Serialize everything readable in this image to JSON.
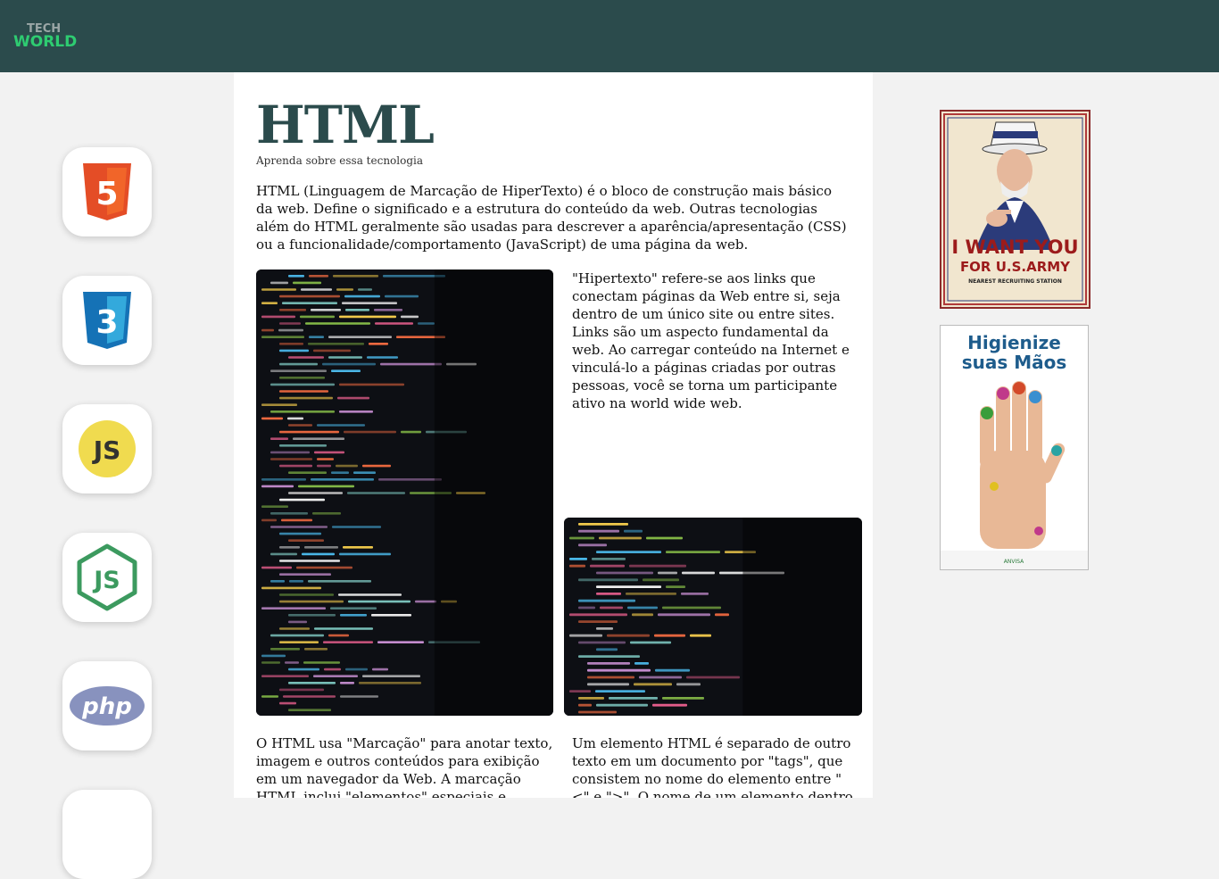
{
  "brand": {
    "line1": "TECH",
    "line2": "WORLD"
  },
  "sidebar": {
    "items": [
      {
        "name": "html5",
        "label": "5"
      },
      {
        "name": "css3",
        "label": "3"
      },
      {
        "name": "javascript",
        "label": "JS"
      },
      {
        "name": "nodejs",
        "label": "JS"
      },
      {
        "name": "php",
        "label": "php"
      }
    ]
  },
  "article": {
    "title": "HTML",
    "subtitle": "Aprenda sobre essa tecnologia",
    "intro": "HTML (Linguagem de Marcação de HiperTexto) é o bloco de construção mais básico da web. Define o significado e a estrutura do conteúdo da web. Outras tecnologias além do HTML geralmente são usadas para descrever a aparência/apresentação (CSS) ou a funcionalidade/comportamento (JavaScript) de uma página da web.",
    "hypertext": "\"Hipertexto\" refere-se aos links que conectam páginas da Web entre si, seja dentro de um único site ou entre sites. Links são um aspecto fundamental da web. Ao carregar conteúdo na Internet e vinculá-lo a páginas criadas por outras pessoas, você se torna um participante ativo na world wide web.",
    "markup": "O HTML usa \"Marcação\" para anotar texto, imagem e outros conteúdos para exibição em um navegador da Web. A marcação HTML inclui \"elementos\" especiais e muitos outros",
    "tags": "Um elemento HTML é separado de outro texto em um documento por \"tags\", que consistem no nome do elemento entre \"<\" e \">\". O nome de um elemento dentro de uma tag é insensível"
  },
  "ads": {
    "army": {
      "line1": "I WANT YOU",
      "line2": "FOR U.S.ARMY",
      "line3": "NEAREST RECRUITING STATION"
    },
    "hygiene": {
      "line1": "Higienize",
      "line2": "suas Mãos",
      "footer": "ANVISA"
    }
  },
  "colors": {
    "header": "#2b4b4c",
    "accent_green": "#2ecc71",
    "title": "#2b4b4c"
  }
}
